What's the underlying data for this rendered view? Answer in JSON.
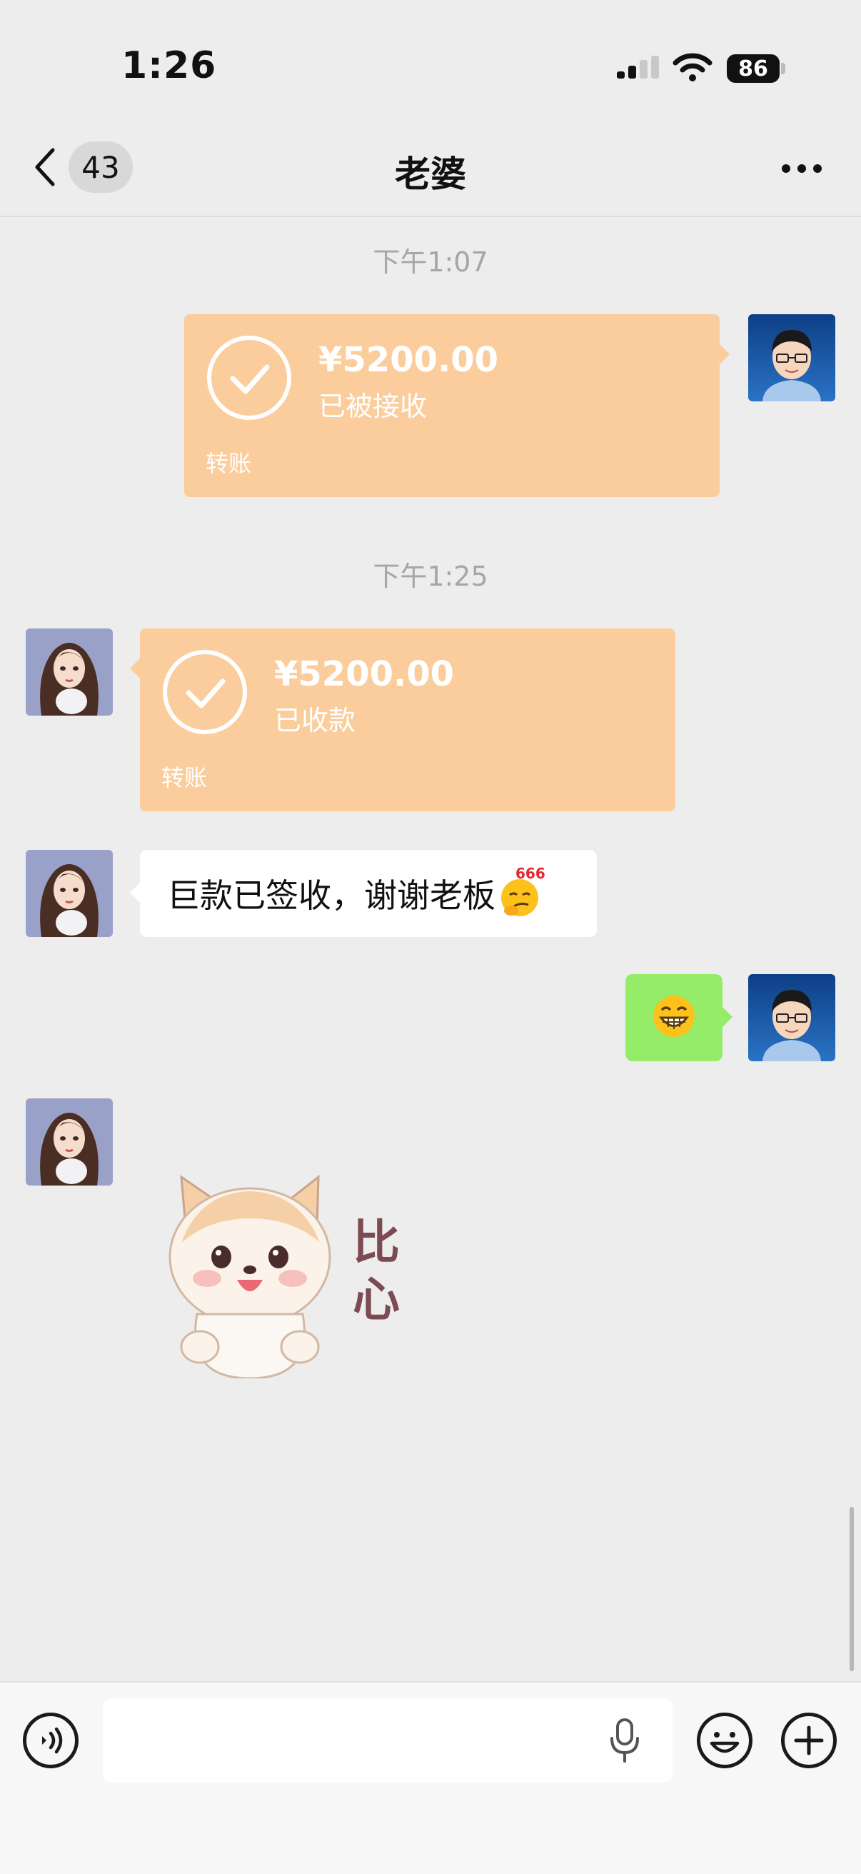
{
  "status_bar": {
    "time": "1:26",
    "battery": "86"
  },
  "nav": {
    "unread_count": "43",
    "title": "老婆"
  },
  "messages": [
    {
      "type": "timestamp",
      "text": "下午1:07"
    },
    {
      "type": "transfer",
      "side": "sent",
      "amount": "¥5200.00",
      "status": "已被接收",
      "label": "转账"
    },
    {
      "type": "timestamp",
      "text": "下午1:25"
    },
    {
      "type": "transfer",
      "side": "received",
      "amount": "¥5200.00",
      "status": "已收款",
      "label": "转账"
    },
    {
      "type": "text",
      "side": "received",
      "text": "巨款已签收，谢谢老板",
      "emoji_badge": "666"
    },
    {
      "type": "emoji",
      "side": "sent",
      "emoji": "grin"
    },
    {
      "type": "sticker",
      "side": "received",
      "sticker_text": "比心"
    }
  ],
  "input_bar": {
    "text": "",
    "icons": [
      "voice-icon",
      "microphone-icon",
      "emoji-icon",
      "plus-icon"
    ]
  },
  "colors": {
    "transfer": "#fbcd9c",
    "sent_bubble": "#95ec69",
    "background": "#ededed"
  }
}
